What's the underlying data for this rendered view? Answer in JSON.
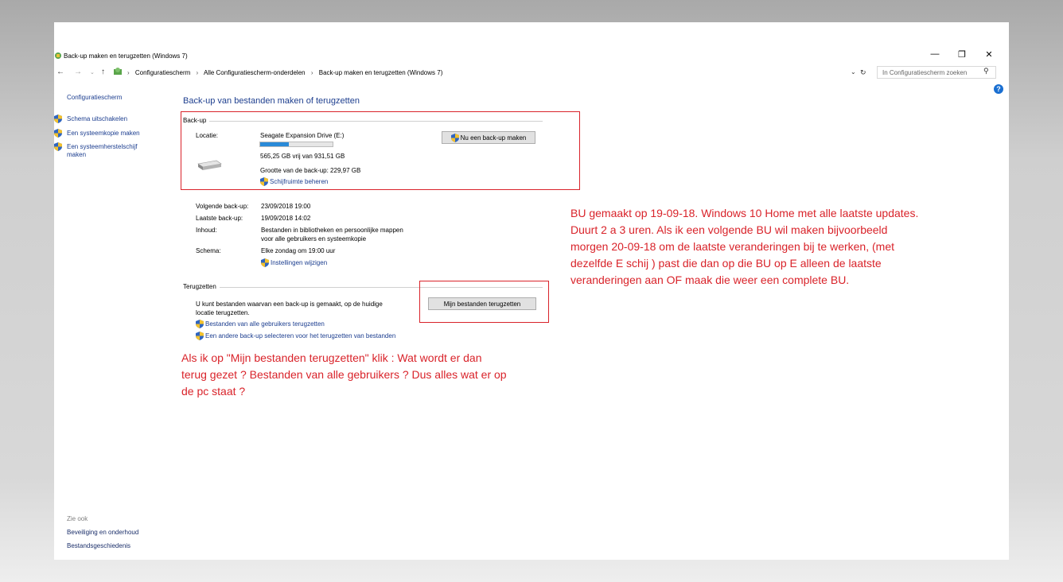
{
  "window": {
    "title": "Back-up maken en terugzetten (Windows 7)"
  },
  "address": {
    "crumbs": [
      "Configuratiescherm",
      "Alle Configuratiescherm-onderdelen",
      "Back-up maken en terugzetten (Windows 7)"
    ],
    "search_placeholder": "In Configuratiescherm zoeken"
  },
  "sidebar": {
    "home": "Configuratiescherm",
    "items": [
      "Schema uitschakelen",
      "Een systeemkopie maken",
      "Een systeemherstelschijf maken"
    ],
    "see_also_label": "Zie ook",
    "see_also": [
      "Beveiliging en onderhoud",
      "Bestandsgeschiedenis"
    ]
  },
  "main": {
    "title": "Back-up van bestanden maken of terugzetten",
    "backup": {
      "group_label": "Back-up",
      "location_label": "Locatie:",
      "drive_name": "Seagate Expansion Drive (E:)",
      "free_space": "565,25 GB vrij van 931,51 GB",
      "used_fraction": 0.393,
      "size_text": "Grootte van de back-up: 229,97 GB",
      "manage_link": "Schijfruimte beheren",
      "backup_now_button": "Nu een back-up maken"
    },
    "details": {
      "next_label": "Volgende back-up:",
      "next_value": "23/09/2018 19:00",
      "last_label": "Laatste back-up:",
      "last_value": "19/09/2018 14:02",
      "content_label": "Inhoud:",
      "content_line1": "Bestanden in bibliotheken en persoonlijke mappen",
      "content_line2": "voor alle gebruikers en systeemkopie",
      "schedule_label": "Schema:",
      "schedule_value": "Elke zondag om 19:00 uur",
      "settings_link": "Instellingen wijzigen"
    },
    "restore": {
      "group_label": "Terugzetten",
      "text_line1": "U kunt bestanden waarvan een back-up is gemaakt, op de huidige",
      "text_line2": "locatie terugzetten.",
      "restore_button": "Mijn bestanden terugzetten",
      "all_users_link": "Bestanden van alle gebruikers terugzetten",
      "other_backup_link": "Een andere back-up selecteren voor het terugzetten van bestanden"
    }
  },
  "annotations": {
    "note_right": [
      "BU gemaakt op 19-09-18.  Windows 10 Home met alle laatste updates.",
      "Duurt 2 a 3 uren.  Als ik een volgende BU wil maken bijvoorbeeld",
      "morgen 20-09-18 om de laatste veranderingen bij te  werken, (met",
      "dezelfde E schij )  past die dan op die BU op E alleen de laatste",
      "veranderingen aan OF maak die weer een complete BU."
    ],
    "note_bottom": [
      "Als ik op  \"Mijn bestanden terugzetten\" klik : Wat wordt er dan",
      "terug gezet ? Bestanden van alle gebruikers ? Dus alles wat er op",
      "de pc staat ?"
    ],
    "color": "#d9232a"
  }
}
